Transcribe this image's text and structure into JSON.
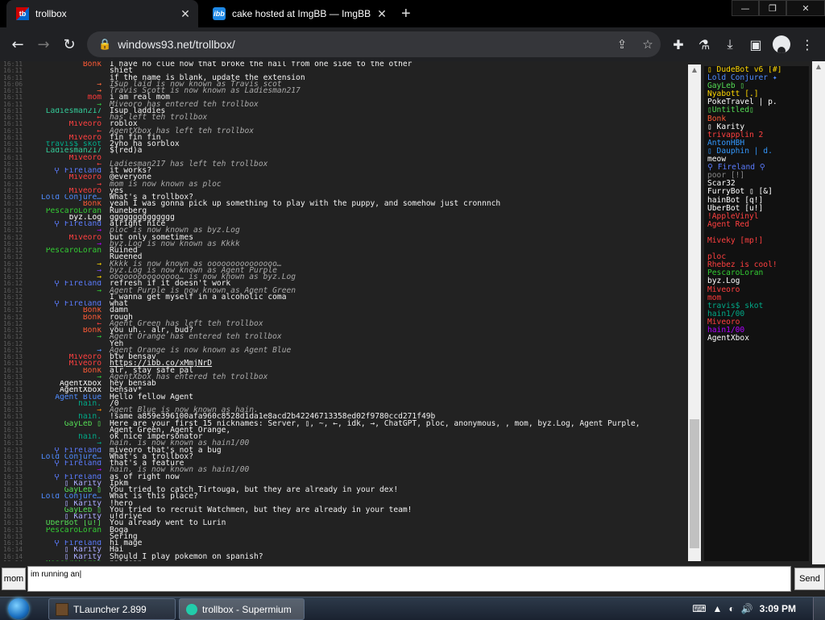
{
  "browser": {
    "tabs": [
      {
        "title": "trollbox",
        "favicon": "trollbox-icon",
        "active": true
      },
      {
        "title": "cake hosted at ImgBB — ImgBB",
        "favicon": "imgbb-icon",
        "active": false
      }
    ],
    "favicon_tb": "tb",
    "favicon_ibb": "ibb",
    "newtab": "+",
    "url": "windows93.net/trollbox/"
  },
  "chat": {
    "messages": [
      {
        "t": "16:11",
        "nick": "Bonk",
        "nc": "#ff5a36",
        "msg": "I have no clue how that broke the nail from one side to the other"
      },
      {
        "t": "16:11",
        "nick": "",
        "nc": "#2e3ea8",
        "msg": "shiet"
      },
      {
        "t": "16:11",
        "nick": "",
        "nc": "#9a3a9a",
        "msg": "if the name is blank, update the extension"
      },
      {
        "t": "16:06",
        "nick": "→",
        "nc": "#ff6a3a",
        "sys": true,
        "msg": "I$up laid is now known as Travis scot"
      },
      {
        "t": "16:11",
        "nick": "→",
        "nc": "#ff6a3a",
        "sys": true,
        "msg": "Travis Scott is now known as Ladiesman217"
      },
      {
        "t": "16:11",
        "nick": "mom",
        "nc": "#ff3a3a",
        "msg": "i am real mom"
      },
      {
        "t": "16:11",
        "nick": "→",
        "nc": "#2ecc40",
        "sys": true,
        "msg": "Miveoro has entered teh trollbox"
      },
      {
        "t": "16:11",
        "nick": "Ladiesman217",
        "nc": "#33cc99",
        "msg": "Isup laddies"
      },
      {
        "t": "16:11",
        "nick": "←",
        "nc": "#ff4040",
        "sys": true,
        "msg": "has left teh trollbox"
      },
      {
        "t": "16:11",
        "nick": "Miveoro",
        "nc": "#ff4040",
        "msg": "roblox"
      },
      {
        "t": "16:11",
        "nick": "←",
        "nc": "#ff4040",
        "sys": true,
        "msg": "AgentXbox has left teh trollbox"
      },
      {
        "t": "16:11",
        "nick": "Miveoro",
        "nc": "#ff4040",
        "msg": "fin fin fin"
      },
      {
        "t": "16:11",
        "nick": "travis$ skot",
        "nc": "#00aa88",
        "msg": "2yho ha sorblox"
      },
      {
        "t": "16:11",
        "nick": "Ladiesman217",
        "nc": "#33cc99",
        "msg": "$(red)a"
      },
      {
        "t": "16:11",
        "nick": "Miveoro",
        "nc": "#ff4040",
        "msg": ""
      },
      {
        "t": "16:11",
        "nick": "←",
        "nc": "#ff4040",
        "sys": true,
        "msg": "Ladiesman217 has left teh trollbox"
      },
      {
        "t": "16:12",
        "nick": "⚲ Fireland",
        "nc": "#5b7cff",
        "msg": "it works?"
      },
      {
        "t": "16:12",
        "nick": "Miveoro",
        "nc": "#ff4040",
        "msg": "@everyone"
      },
      {
        "t": "16:12",
        "nick": "→",
        "nc": "#ff4040",
        "sys": true,
        "msg": "mom is now known as ploc"
      },
      {
        "t": "16:12",
        "nick": "Miveoro",
        "nc": "#ff4040",
        "msg": "yes"
      },
      {
        "t": "16:12",
        "nick": "Lold Conjure…",
        "nc": "#4f8cff",
        "msg": "What's a trollbox?"
      },
      {
        "t": "16:12",
        "nick": "Bonk",
        "nc": "#ff5a36",
        "msg": "yeah I was gonna pick up something to play with the puppy, and somehow just cronnnch"
      },
      {
        "t": "16:12",
        "nick": "PescaroLoran",
        "nc": "#33cc33",
        "msg": "Runeberg"
      },
      {
        "t": "16:12",
        "nick": "byz.Log",
        "nc": "#ffffff",
        "msg": "gggggggggggggg"
      },
      {
        "t": "16:12",
        "nick": "⚲ Fireland",
        "nc": "#5b7cff",
        "msg": "alright nice"
      },
      {
        "t": "16:12",
        "nick": "→",
        "nc": "#b000ff",
        "sys": true,
        "msg": "ploc is now known as byz.Log"
      },
      {
        "t": "16:12",
        "nick": "Miveoro",
        "nc": "#ff4040",
        "msg": "but only sometimes"
      },
      {
        "t": "16:12",
        "nick": "→",
        "nc": "#b000ff",
        "sys": true,
        "msg": "byz.Log is now known as Kkkk"
      },
      {
        "t": "16:12",
        "nick": "PescaroLoran",
        "nc": "#33cc33",
        "msg": "Ruined"
      },
      {
        "t": "16:12",
        "nick": "",
        "nc": "#ffffff",
        "msg": "Rueened"
      },
      {
        "t": "16:12",
        "nick": "→",
        "nc": "#ffd700",
        "sys": true,
        "msg": "Kkkk is now known as ooooooooooooooo…"
      },
      {
        "t": "16:12",
        "nick": "→",
        "nc": "#7a4cff",
        "sys": true,
        "msg": "byz.Log is now known as Agent Purple"
      },
      {
        "t": "16:12",
        "nick": "→",
        "nc": "#ffd700",
        "sys": true,
        "msg": "ooooooooooooooo… is now known as byz.Log"
      },
      {
        "t": "16:12",
        "nick": "⚲ Fireland",
        "nc": "#5b7cff",
        "msg": "refresh if it doesn't work"
      },
      {
        "t": "16:12",
        "nick": "→",
        "nc": "#33cc33",
        "sys": true,
        "msg": "Agent Purple is now known as Agent Green"
      },
      {
        "t": "16:12",
        "nick": "",
        "nc": "#2e3ea8",
        "msg": "I wanna get myself in a alcoholic coma"
      },
      {
        "t": "16:12",
        "nick": "⚲ Fireland",
        "nc": "#5b7cff",
        "msg": "what"
      },
      {
        "t": "16:12",
        "nick": "Bonk",
        "nc": "#ff5a36",
        "msg": "damn"
      },
      {
        "t": "16:12",
        "nick": "Bonk",
        "nc": "#ff5a36",
        "msg": "rough"
      },
      {
        "t": "16:12",
        "nick": "←",
        "nc": "#ff4040",
        "sys": true,
        "msg": "Agent Green has left teh trollbox"
      },
      {
        "t": "16:12",
        "nick": "Bonk",
        "nc": "#ff5a36",
        "msg": "you uh.. alr, bud?"
      },
      {
        "t": "16:12",
        "nick": "→",
        "nc": "#2ecc40",
        "sys": true,
        "msg": "Agent Orange has entered teh trollbox"
      },
      {
        "t": "16:12",
        "nick": "",
        "nc": "#2e3ea8",
        "msg": "Yeh"
      },
      {
        "t": "16:12",
        "nick": "→",
        "nc": "#4f8cff",
        "sys": true,
        "msg": "Agent Orange is now known as Agent Blue"
      },
      {
        "t": "16:13",
        "nick": "Miveoro",
        "nc": "#ff4040",
        "msg": "btw bensav"
      },
      {
        "t": "16:13",
        "nick": "Miveoro",
        "nc": "#ff4040",
        "msg": "https://ibb.co/xMmjNrD"
      },
      {
        "t": "16:13",
        "nick": "Bonk",
        "nc": "#ff5a36",
        "msg": "alr, stay safe pal"
      },
      {
        "t": "16:13",
        "nick": "→",
        "nc": "#2ecc40",
        "sys": true,
        "msg": "AgentXbox has entered teh trollbox"
      },
      {
        "t": "16:13",
        "nick": "AgentXbox",
        "nc": "#ffffff",
        "msg": "hey bensab"
      },
      {
        "t": "16:13",
        "nick": "AgentXbox",
        "nc": "#ffffff",
        "msg": "bensav*"
      },
      {
        "t": "16:13",
        "nick": "Agent Blue",
        "nc": "#4f8cff",
        "msg": "Hello fellow Agent"
      },
      {
        "t": "16:13",
        "nick": "hain.",
        "nc": "#00aa88",
        "msg": "/0"
      },
      {
        "t": "16:13",
        "nick": "→",
        "nc": "#ff8c00",
        "sys": true,
        "msg": "Agent Blue is now known as hain."
      },
      {
        "t": "16:13",
        "nick": "hain.",
        "nc": "#00aa88",
        "msg": "!same a859e396100afa960c8528d1da1e8acd2b42246713358ed02f9780ccd271f49b"
      },
      {
        "t": "16:13",
        "nick": "GayLeb ▯",
        "nc": "#55dd55",
        "msg": "Here are your first 15 nicknames: Server, ▯, ~, ←, idk, →, ChatGPT, ploc, anonymous,  , mom, byz.Log, Agent Purple,"
      },
      {
        "t": "16:13",
        "nick": "",
        "nc": "#ffffff",
        "msg": "Agent Green, Agent Orange,"
      },
      {
        "t": "16:13",
        "nick": "hain.",
        "nc": "#00aa88",
        "msg": "ok nice impersonator"
      },
      {
        "t": "16:13",
        "nick": "→",
        "nc": "#00aa88",
        "sys": true,
        "msg": "hain. is now known as hain1/00"
      },
      {
        "t": "16:13",
        "nick": "⚲ Fireland",
        "nc": "#5b7cff",
        "msg": "miveoro that's not a bug"
      },
      {
        "t": "16:13",
        "nick": "Lold Conjure…",
        "nc": "#4f8cff",
        "msg": "What's a trollbox?"
      },
      {
        "t": "16:13",
        "nick": "⚲ Fireland",
        "nc": "#5b7cff",
        "msg": "that's a feature"
      },
      {
        "t": "16:13",
        "nick": "→",
        "nc": "#b000ff",
        "sys": true,
        "msg": "hain. is now known as hain1/00"
      },
      {
        "t": "16:13",
        "nick": "⚲ Fireland",
        "nc": "#5b7cff",
        "msg": "as of right now"
      },
      {
        "t": "16:13",
        "nick": "▯ Karity",
        "nc": "#aaaaff",
        "msg": "Ipkm"
      },
      {
        "t": "16:13",
        "nick": "GayLeb ▯",
        "nc": "#55dd55",
        "msg": "You tried to catch Tirtouga, but they are already in your dex!"
      },
      {
        "t": "16:13",
        "nick": "Lold Conjure…",
        "nc": "#4f8cff",
        "msg": "What is this place?"
      },
      {
        "t": "16:13",
        "nick": "▯ Karity",
        "nc": "#aaaaff",
        "msg": "!hero"
      },
      {
        "t": "16:13",
        "nick": "GayLeb ▯",
        "nc": "#55dd55",
        "msg": "You tried to recruit Watchmen, but they are already in your team!"
      },
      {
        "t": "16:13",
        "nick": "▯ Karity",
        "nc": "#aaaaff",
        "msg": "u!drive"
      },
      {
        "t": "16:13",
        "nick": "UberBot [u!]",
        "nc": "#55dd55",
        "msg": "You already went to Lurin"
      },
      {
        "t": "16:13",
        "nick": "PescaroLoran",
        "nc": "#33cc33",
        "msg": "Boga"
      },
      {
        "t": "16:13",
        "nick": "",
        "nc": "#ffffff",
        "msg": "Sering"
      },
      {
        "t": "16:14",
        "nick": "⚲ Fireland",
        "nc": "#5b7cff",
        "msg": "hi mage"
      },
      {
        "t": "16:14",
        "nick": "▯ Karity",
        "nc": "#aaaaff",
        "msg": "Hai"
      },
      {
        "t": "16:14",
        "nick": "▯ Karity",
        "nc": "#aaaaff",
        "msg": "Should I play pokemon on spanish?"
      },
      {
        "t": "16:14",
        "nick": "PescaroLoran",
        "nc": "#33cc33",
        "msg": "paldean"
      }
    ],
    "users": [
      {
        "name": "▯ DudeBot v6 [#]",
        "c": "#ffd700"
      },
      {
        "name": "Lold Conjurer ✦",
        "c": "#4f8cff"
      },
      {
        "name": "GayLeb ▯",
        "c": "#55dd55"
      },
      {
        "name": "Nyabott [.]",
        "c": "#ffd700"
      },
      {
        "name": "PokeTravel | p.",
        "c": "#ffffff"
      },
      {
        "name": "▯Untitled▯",
        "c": "#55dd55"
      },
      {
        "name": "Bonk",
        "c": "#ff5a36"
      },
      {
        "name": "▯ Karity",
        "c": "#ffffff"
      },
      {
        "name": "trivapplin 2",
        "c": "#ff4040"
      },
      {
        "name": "AntonHBH",
        "c": "#3399ff"
      },
      {
        "name": "▯ Dauphin | d.",
        "c": "#3399ff"
      },
      {
        "name": "meow",
        "c": "#ffffff"
      },
      {
        "name": "⚲ Fireland ⚲",
        "c": "#5b7cff"
      },
      {
        "name": "poor [!]",
        "c": "#888888"
      },
      {
        "name": "Scar32",
        "c": "#ffffff"
      },
      {
        "name": "FurryBot ▯ [&]",
        "c": "#ffffff"
      },
      {
        "name": "hainBot [q!]",
        "c": "#ffffff"
      },
      {
        "name": "UberBot [u!]",
        "c": "#ffffff"
      },
      {
        "name": "!AppleVinyl",
        "c": "#ff4040"
      },
      {
        "name": "Agent Red",
        "c": "#ff4040"
      },
      {
        "name": "",
        "c": "#2ecc40"
      },
      {
        "name": "Miveky [mp!]",
        "c": "#ff4040"
      },
      {
        "name": "",
        "c": "#2e3ea8"
      },
      {
        "name": "ploc",
        "c": "#ff4040"
      },
      {
        "name": "Rhebez is cool!",
        "c": "#ff4040"
      },
      {
        "name": "PescaroLoran",
        "c": "#33cc33"
      },
      {
        "name": "byz.Log",
        "c": "#ffffff"
      },
      {
        "name": "Miveoro",
        "c": "#ff4040"
      },
      {
        "name": "mom",
        "c": "#ff3a3a"
      },
      {
        "name": "travis$ skot",
        "c": "#00aa88"
      },
      {
        "name": "hain1/00",
        "c": "#00aa88"
      },
      {
        "name": "Miveoro",
        "c": "#ff4040"
      },
      {
        "name": "hain1/00",
        "c": "#b000ff"
      },
      {
        "name": "AgentXbox",
        "c": "#ffffff"
      }
    ]
  },
  "input": {
    "nick_label": "mom",
    "message_value": "im running an|",
    "send_label": "Send"
  },
  "taskbar": {
    "items": [
      {
        "label": "TLauncher 2.899",
        "active": false
      },
      {
        "label": "trollbox - Supermium",
        "active": true
      }
    ],
    "clock": "3:09 PM"
  }
}
